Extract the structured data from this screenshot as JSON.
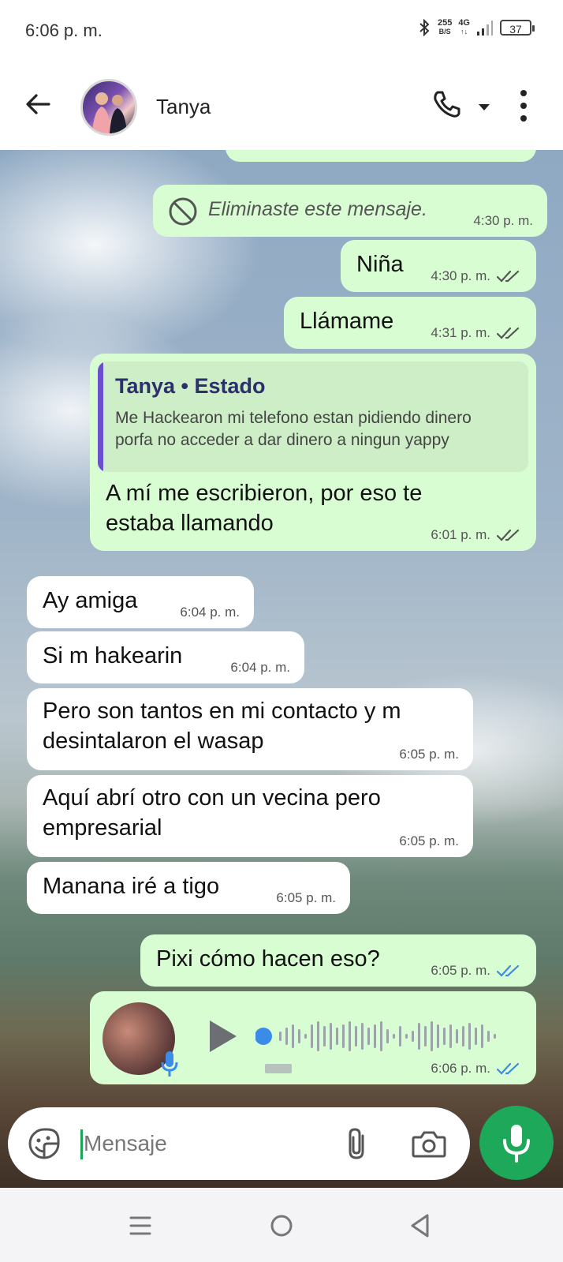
{
  "status_bar": {
    "time": "6:06 p. m.",
    "net_speed_value": "255",
    "net_speed_unit": "B/S",
    "network_type": "4G",
    "battery": "37"
  },
  "header": {
    "contact_name": "Tanya"
  },
  "messages": [
    {
      "direction": "outgoing",
      "text": "Eliminaste este mensaje.",
      "deleted": true,
      "time": "4:30 p. m."
    },
    {
      "direction": "outgoing",
      "text": "Niña",
      "time": "4:30 p. m.",
      "ticks": "read-gray"
    },
    {
      "direction": "outgoing",
      "text": "Llámame",
      "time": "4:31 p. m.",
      "ticks": "read-gray"
    },
    {
      "direction": "outgoing",
      "reply": {
        "title": "Tanya • Estado",
        "text": "Me Hackearon mi telefono estan pidiendo dinero porfa no acceder a dar dinero a ningun yappy"
      },
      "text": "A mí me escribieron, por eso te estaba llamando",
      "time": "6:01 p. m.",
      "ticks": "read-gray"
    },
    {
      "direction": "incoming",
      "text": "Ay amiga",
      "time": "6:04 p. m."
    },
    {
      "direction": "incoming",
      "text": "Si m hakearin",
      "time": "6:04 p. m."
    },
    {
      "direction": "incoming",
      "text": "Pero son tantos en mi contacto y m desintalaron el wasap",
      "time": "6:05 p. m."
    },
    {
      "direction": "incoming",
      "text": "Aquí abrí otro con un vecina pero empresarial",
      "time": "6:05 p. m."
    },
    {
      "direction": "incoming",
      "text": "Manana iré a tigo",
      "time": "6:05 p. m."
    },
    {
      "direction": "outgoing",
      "text": "Pixi cómo hacen eso?",
      "time": "6:05 p. m.",
      "ticks": "read-blue"
    },
    {
      "direction": "outgoing",
      "type": "voice",
      "time": "6:06 p. m.",
      "ticks": "read-blue"
    }
  ],
  "composer": {
    "placeholder": "Mensaje"
  },
  "colors": {
    "outgoing_bubble": "#d9fdd3",
    "incoming_bubble": "#ffffff",
    "accent_green": "#1da85a",
    "read_tick_blue": "#3d8be8",
    "reply_bar": "#6a4fd0"
  },
  "icons": [
    "back-arrow-icon",
    "phone-icon",
    "chevron-down-icon",
    "more-vert-icon",
    "blocked-icon",
    "double-check-icon",
    "play-icon",
    "microphone-icon",
    "sticker-icon",
    "paperclip-icon",
    "camera-icon",
    "menu-icon",
    "home-icon",
    "back-triangle-icon"
  ]
}
